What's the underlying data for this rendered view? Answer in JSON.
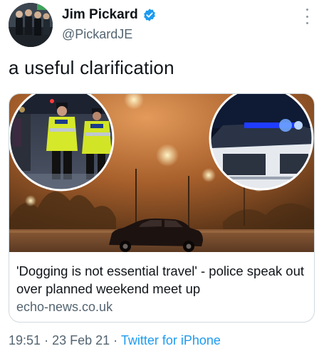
{
  "author": {
    "name": "Jim Pickard",
    "handle": "@PickardJE",
    "verified_icon": "verified-badge-icon",
    "avatar_icon": "profile-photo"
  },
  "more_icon": "more-vertical-icon",
  "tweet": {
    "text": "a useful clarification"
  },
  "link_card": {
    "title": "'Dogging is not essential travel' - police speak out over planned weekend meet up",
    "domain": "echo-news.co.uk",
    "image_icon": "foggy-car-park-photo",
    "inset_left_icon": "police-officers-photo",
    "inset_right_icon": "police-car-lights-photo"
  },
  "meta": {
    "time": "19:51",
    "separator": "·",
    "date": "23 Feb 21",
    "source": "Twitter for iPhone"
  },
  "colors": {
    "accent": "#1d9bf0",
    "secondary_text": "#536471",
    "primary_text": "#0f1419",
    "border": "#cfd9de"
  }
}
